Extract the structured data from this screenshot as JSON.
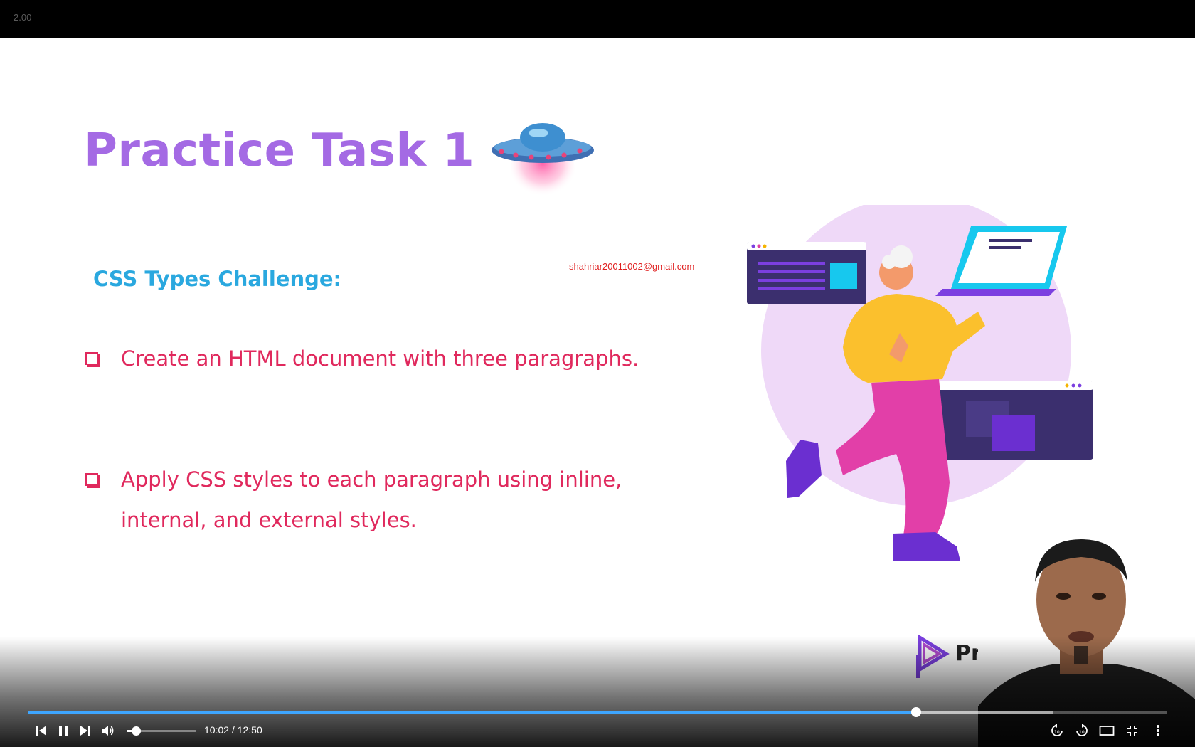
{
  "top_bar": {
    "speed_label": "2.00"
  },
  "slide": {
    "title": "Practice Task 1",
    "subtitle": "CSS Types Challenge:",
    "watermark_email": "shahriar20011002@gmail.com",
    "tasks": [
      {
        "text": "Create an HTML document with three paragraphs."
      },
      {
        "text": "Apply CSS styles to each paragraph using inline, internal, and external styles."
      }
    ],
    "brand_text": "Program"
  },
  "player": {
    "current_time": "10:02",
    "separator": " / ",
    "duration": "12:50",
    "progress_fraction": 0.78,
    "buffered_fraction": 0.9,
    "volume_fraction": 0.12,
    "accent_color": "#3ea6ff",
    "icons": [
      "previous-icon",
      "pause-icon",
      "next-icon",
      "volume-icon",
      "rewind-10-icon",
      "forward-10-icon",
      "theater-mode-icon",
      "exit-fullscreen-icon",
      "more-options-icon"
    ]
  },
  "colors": {
    "title": "#a46ae4",
    "subtitle": "#2aa8df",
    "task_text": "#e0295d",
    "email": "#e01e1e"
  }
}
